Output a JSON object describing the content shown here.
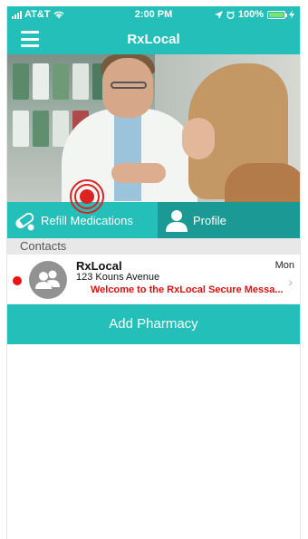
{
  "status_bar": {
    "carrier": "AT&T",
    "time": "2:00 PM",
    "battery": "100%",
    "battery_level": 1.0,
    "icons": [
      "signal-icon",
      "wifi-icon",
      "location-icon",
      "alarm-icon",
      "battery-icon",
      "charging-icon"
    ]
  },
  "nav": {
    "title": "RxLocal",
    "menu_icon": "hamburger-menu-icon"
  },
  "hero": {
    "image": "pharmacist-consulting-customer-photo"
  },
  "actions": {
    "refill_label": "Refill Medications",
    "refill_icon": "pill-icon",
    "profile_label": "Profile",
    "profile_icon": "person-icon"
  },
  "contacts": {
    "header": "Contacts",
    "items": [
      {
        "name": "RxLocal",
        "address": "123 Kouns Avenue",
        "message": "Welcome to the RxLocal Secure Messa...",
        "day": "Mon",
        "unread": true
      }
    ]
  },
  "footer": {
    "add_pharmacy_label": "Add Pharmacy"
  },
  "colors": {
    "primary": "#25bfb9",
    "primary_dark": "#1b9a95",
    "unread": "#ee1111",
    "message": "#e01111"
  }
}
